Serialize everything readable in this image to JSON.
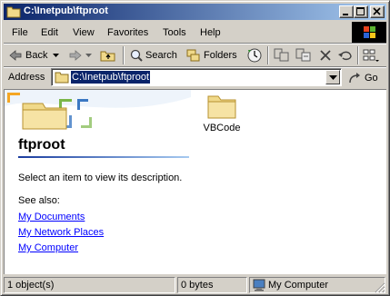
{
  "window": {
    "title": "C:\\Inetpub\\ftproot",
    "title_icon": "folder-icon",
    "controls": [
      "minimize-icon",
      "maximize-icon",
      "close-icon"
    ]
  },
  "menu": {
    "items": [
      "File",
      "Edit",
      "View",
      "Favorites",
      "Tools",
      "Help"
    ],
    "logo": "windows-logo"
  },
  "toolbar": {
    "back_label": "Back",
    "search_label": "Search",
    "folders_label": "Folders",
    "icons": [
      "back-arrow-icon",
      "forward-arrow-icon",
      "up-folder-icon",
      "search-icon",
      "folders-icon",
      "history-icon",
      "move-to-icon",
      "copy-to-icon",
      "delete-icon",
      "undo-icon",
      "views-icon"
    ]
  },
  "address": {
    "label": "Address",
    "value": "C:\\Inetpub\\ftproot",
    "go_label": "Go"
  },
  "left_pane": {
    "folder_name": "ftproot",
    "description": "Select an item to view its description.",
    "see_also_label": "See also:",
    "links": [
      "My Documents",
      "My Network Places",
      "My Computer"
    ]
  },
  "items": [
    {
      "name": "VBCode",
      "icon": "folder-icon"
    }
  ],
  "status": {
    "objects": "1 object(s)",
    "size": "0 bytes",
    "zone": "My Computer"
  },
  "colors": {
    "title_start": "#0a246a",
    "title_end": "#a6caf0",
    "face": "#d4d0c8",
    "link": "#0000ff",
    "folder": "#f0d98a"
  }
}
